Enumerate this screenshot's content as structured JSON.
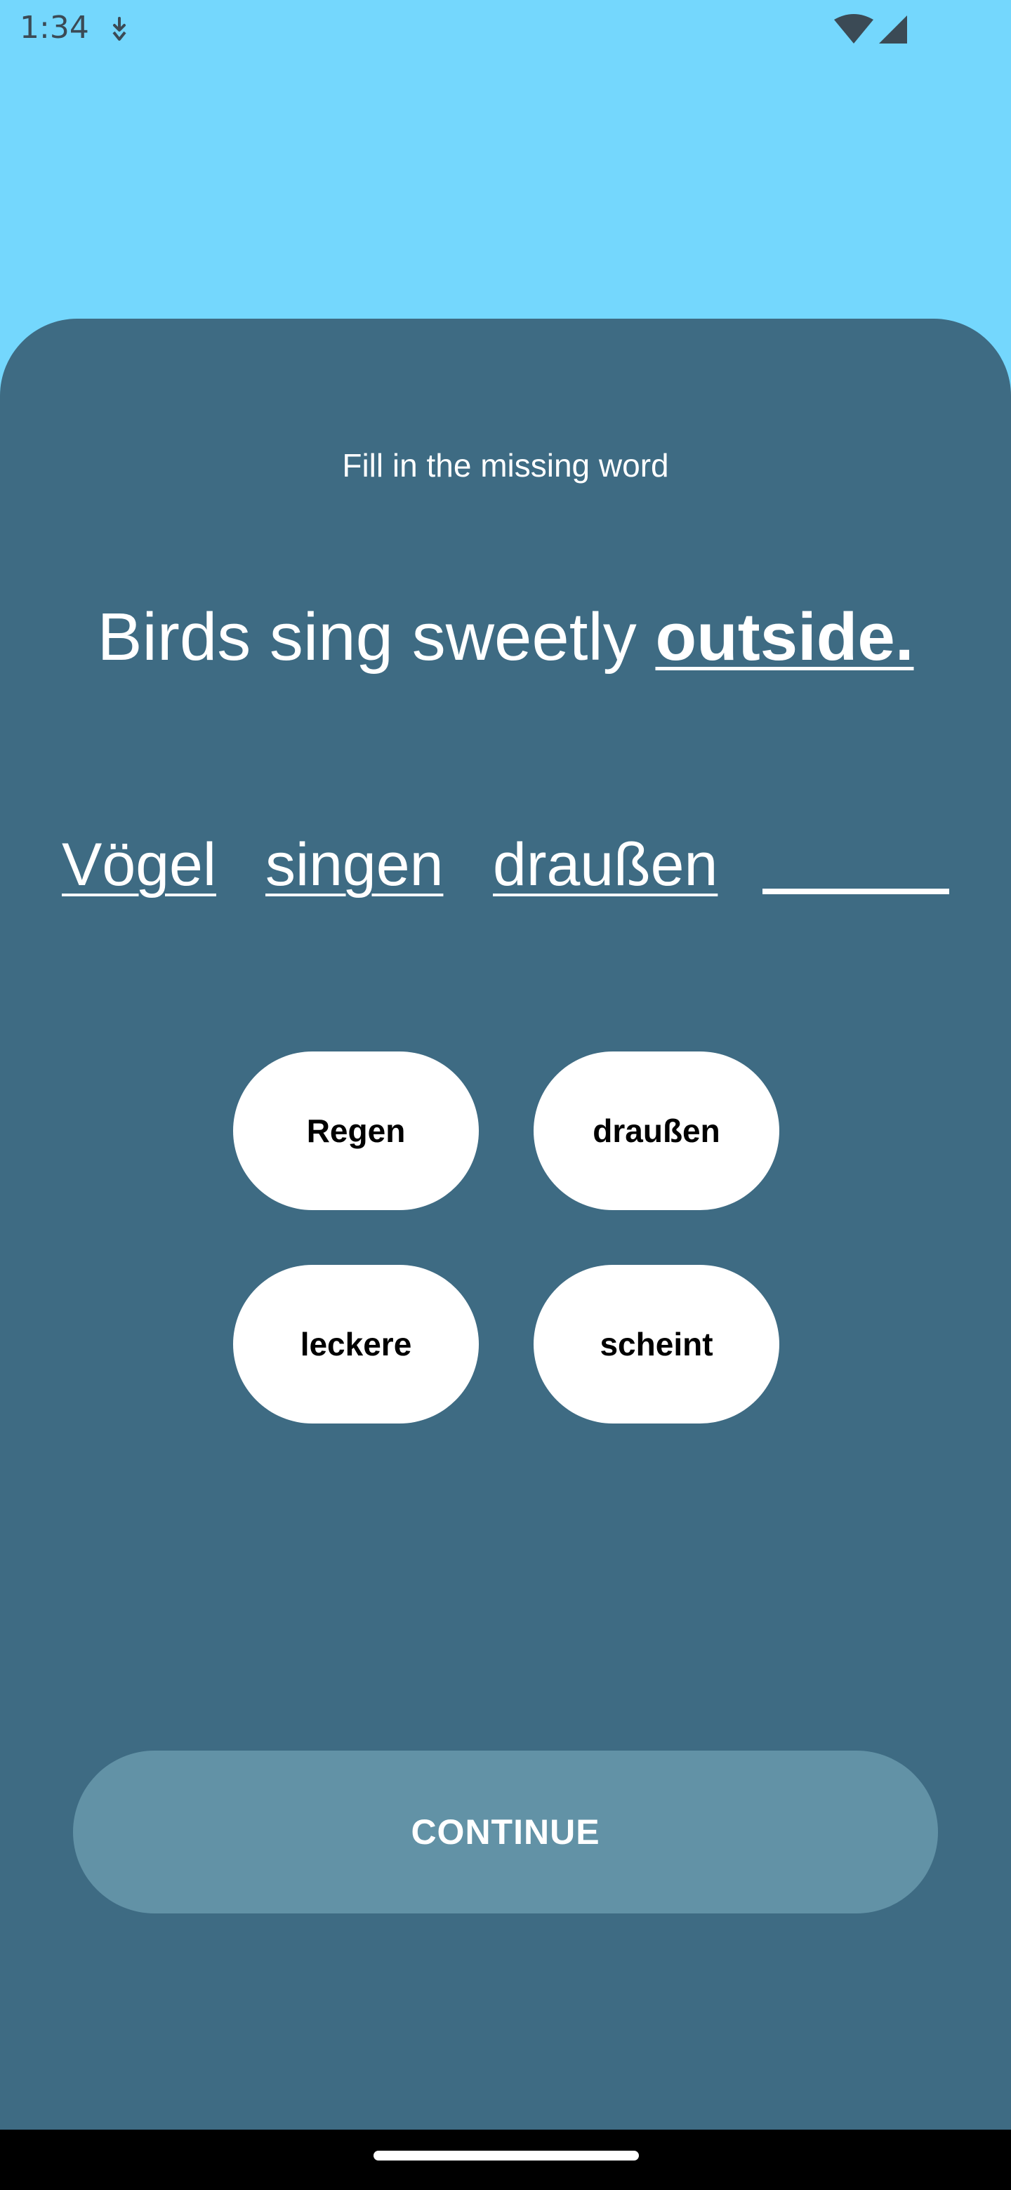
{
  "status_bar": {
    "time": "1:34",
    "icons": [
      "download-icon",
      "wifi-icon",
      "signal-icon"
    ]
  },
  "exercise": {
    "instruction": "Fill in the missing word",
    "sentence_prefix": "Birds sing sweetly ",
    "sentence_highlight": "outside.",
    "answer_words": [
      "Vögel",
      "singen",
      "draußen"
    ],
    "choices": [
      "Regen",
      "draußen",
      "leckere",
      "scheint"
    ]
  },
  "actions": {
    "continue_label": "CONTINUE"
  },
  "colors": {
    "sky": "#74d7fd",
    "panel": "#3e6b83",
    "continue_disabled": "#6292a6",
    "chip": "#ffffff"
  }
}
